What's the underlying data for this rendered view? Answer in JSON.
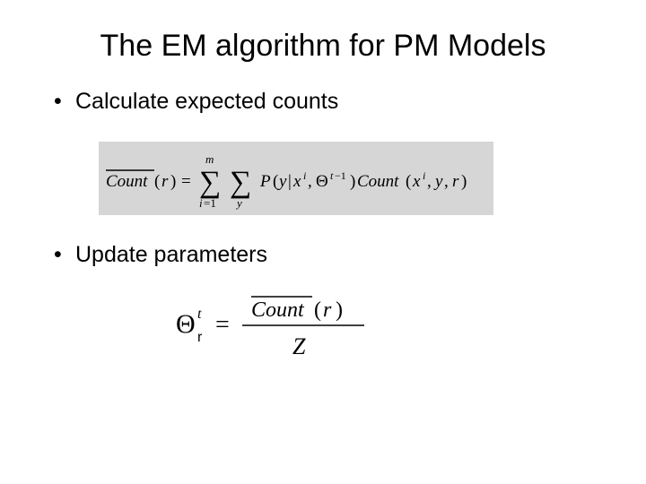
{
  "title": "The EM algorithm for PM Models",
  "bullets": [
    "Calculate expected counts",
    "Update parameters"
  ],
  "equations": {
    "expected_counts": {
      "latex": "\\overline{Count}(r) = \\sum_{i=1}^{m} \\sum_{y} P(y \\mid x^{i}, \\Theta^{t-1}) Count(x^{i}, y, r)",
      "lhs": "\\overline{Count}(r)",
      "rhs_terms": [
        "\\sum_{i=1}^{m}",
        "\\sum_{y}",
        "P(y | x^{i}, \\Theta^{t-1})",
        "Count(x^{i}, y, r)"
      ]
    },
    "update_parameters": {
      "latex": "\\Theta_{r}^{t} = \\dfrac{\\overline{Count}(r)}{Z}",
      "lhs": "\\Theta_{r}^{t}",
      "numerator": "\\overline{Count}(r)",
      "denominator": "Z"
    }
  }
}
